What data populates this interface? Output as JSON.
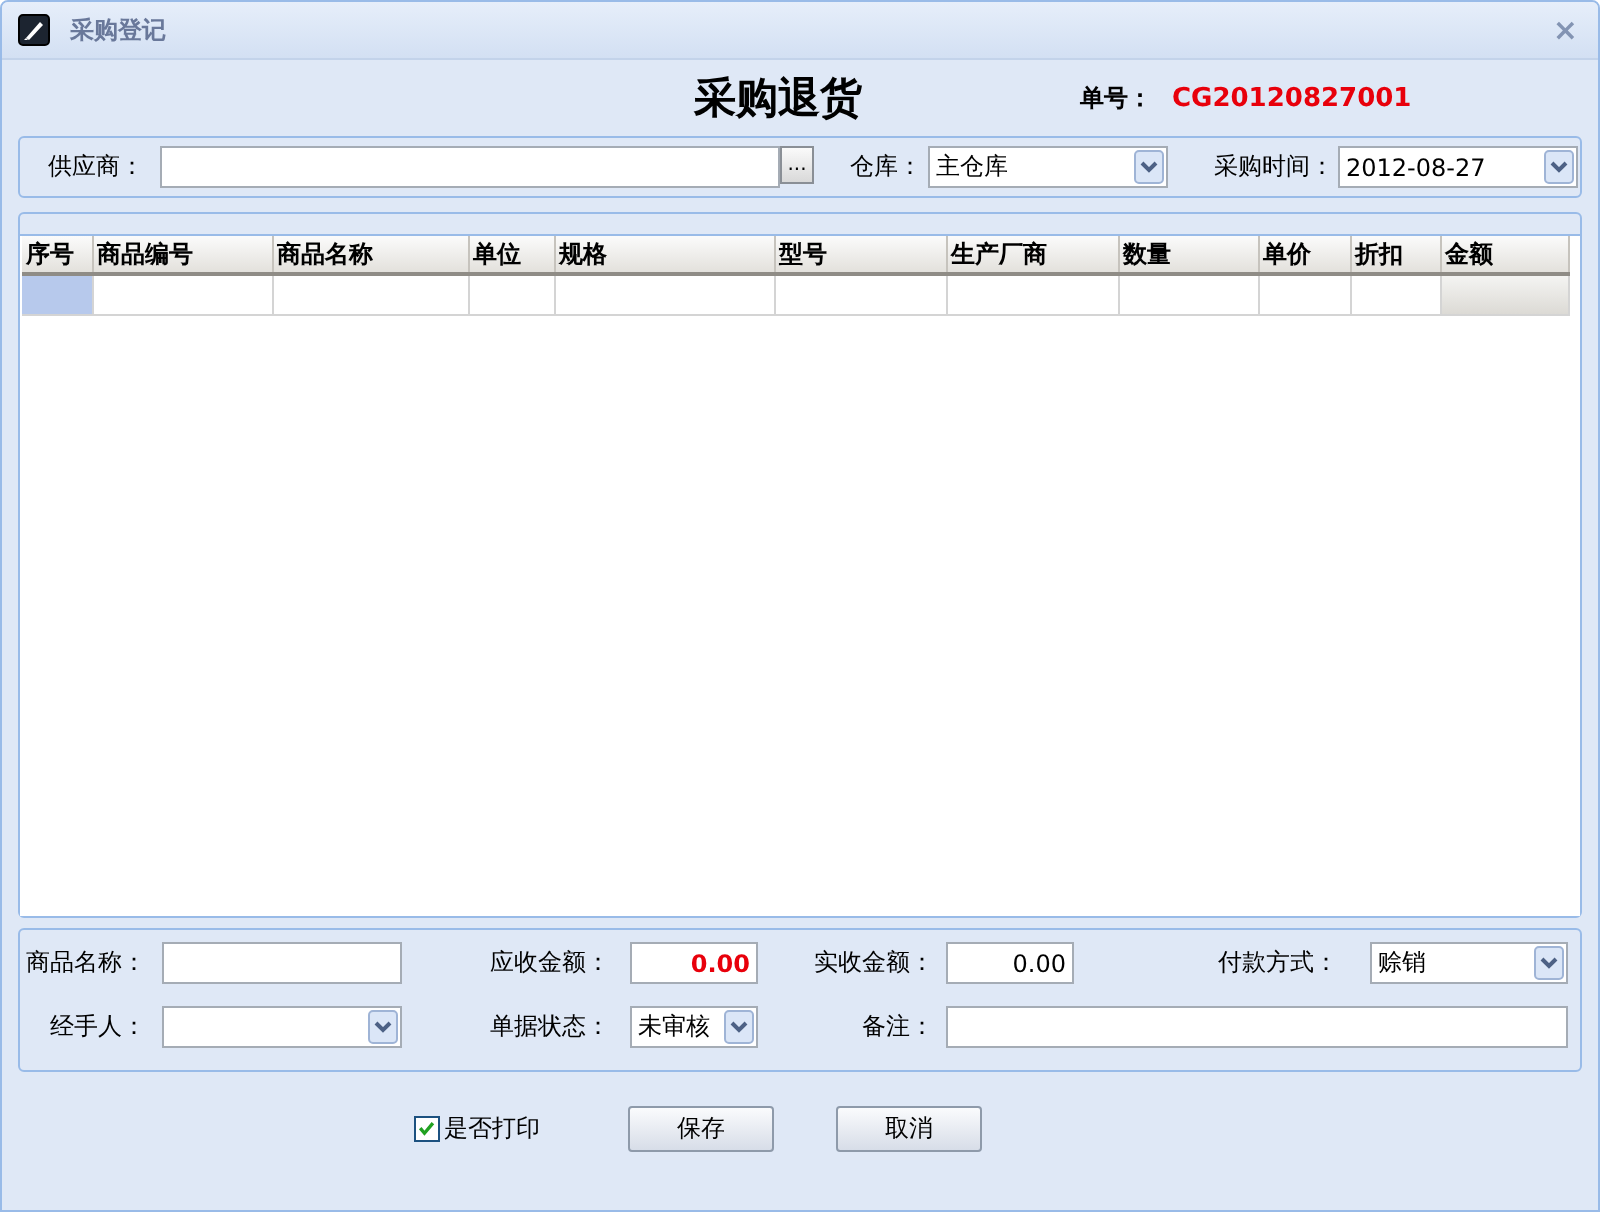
{
  "window": {
    "title": "采购登记",
    "close": "×"
  },
  "heading": "采购退货",
  "order_no": {
    "label": "单号：",
    "value": "CG20120827001"
  },
  "top_fields": [
    {
      "kind": "lookup",
      "label": "供应商：",
      "button": "..."
    },
    {
      "kind": "combo",
      "label": "仓库：",
      "value": "主仓库"
    },
    {
      "kind": "combo",
      "label": "采购时间：",
      "value": "2012-08-27"
    }
  ],
  "table": {
    "columns": [
      "序号",
      "商品编号",
      "商品名称",
      "单位",
      "规格",
      "型号",
      "生产厂商",
      "数量",
      "单价",
      "折扣",
      "金额"
    ],
    "current_row": {
      "selected": true
    }
  },
  "bottom_fields": [
    {
      "kind": "text",
      "label": "商品名称："
    },
    {
      "kind": "amount",
      "label": "应收金额：",
      "value": "0.00",
      "highlight": true
    },
    {
      "kind": "amount",
      "label": "实收金额：",
      "value": "0.00",
      "highlight": false
    },
    {
      "kind": "combo",
      "label": "付款方式：",
      "value": "赊销"
    },
    {
      "kind": "combo",
      "label": "经手人："
    },
    {
      "kind": "combo",
      "label": "单据状态：",
      "value": "未审核"
    },
    {
      "kind": "wide",
      "label": "备注："
    }
  ],
  "print_checkbox": {
    "label": "是否打印",
    "checked": true
  },
  "buttons": [
    "保存",
    "取消"
  ]
}
